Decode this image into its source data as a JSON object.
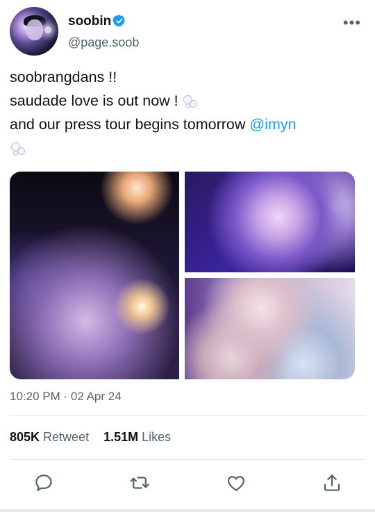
{
  "user": {
    "name": "soobin",
    "handle": "@page.soob"
  },
  "tweet": {
    "line1": "soobrangdans !!",
    "line2": "saudade love is out now !",
    "line3_prefix": "and our press tour begins tomorrow",
    "mention": "@imyn"
  },
  "meta": {
    "timestamp": "10:20 PM · 02 Apr 24"
  },
  "stats": {
    "retweets_count": "805K",
    "retweets_label": "Retweet",
    "likes_count": "1.51M",
    "likes_label": "Likes"
  },
  "icons": [
    "verified-icon",
    "more-icon",
    "bubbles-emoji-icon",
    "reply-icon",
    "retweet-icon",
    "like-icon",
    "share-icon"
  ],
  "colors": {
    "accent": "#1d9bf0",
    "text": "#0f1419",
    "secondary": "#536471"
  }
}
